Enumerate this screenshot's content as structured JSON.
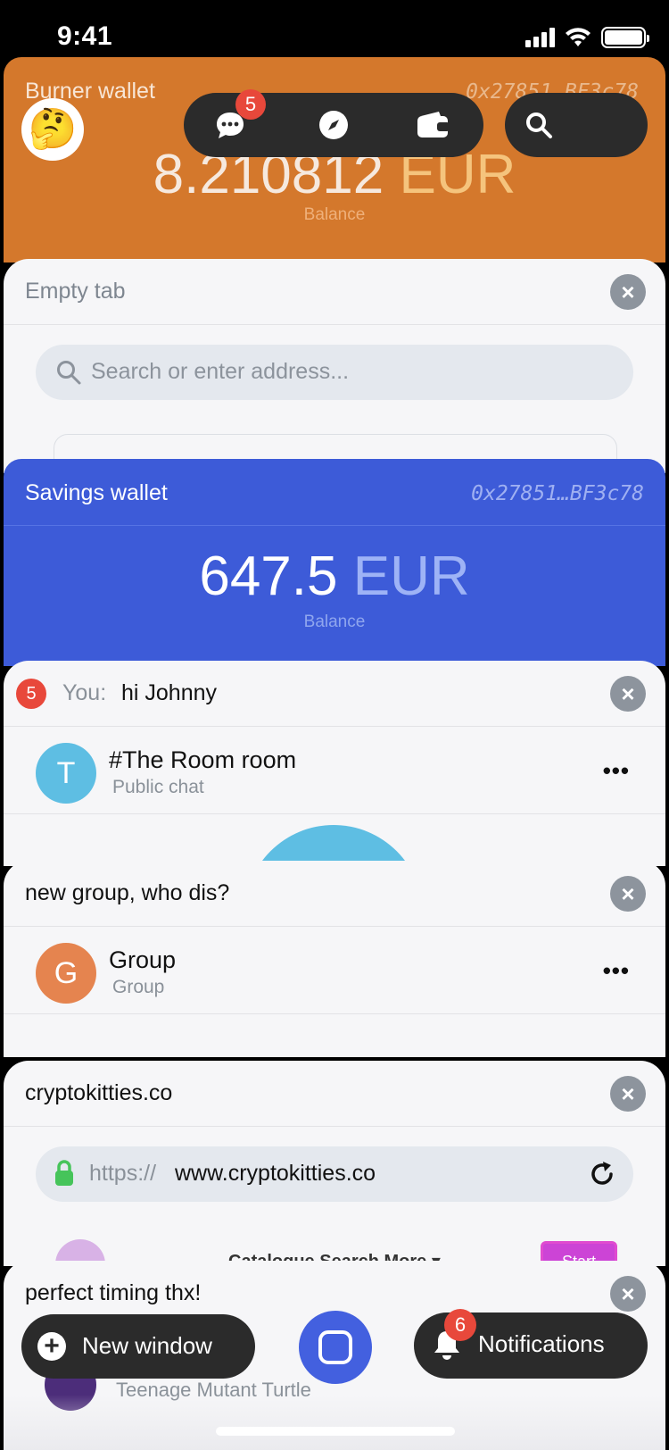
{
  "status_bar": {
    "time": "9:41"
  },
  "nav": {
    "chats_badge": "5",
    "search_placeholder": ""
  },
  "burner_wallet": {
    "title": "Burner wallet",
    "address": "0x27851…BF3c78",
    "amount": "8.210812",
    "currency": "EUR",
    "balance_label": "Balance"
  },
  "empty_tab": {
    "title": "Empty tab",
    "search_placeholder": "Search or enter address..."
  },
  "savings_wallet": {
    "title": "Savings wallet",
    "address": "0x27851…BF3c78",
    "amount": "647.5",
    "currency": "EUR",
    "balance_label": "Balance"
  },
  "room_chat": {
    "unread": "5",
    "sender": "You:",
    "preview": "hi Johnny",
    "avatar_letter": "T",
    "name": "#The Room room",
    "subtitle": "Public chat",
    "more": "•••"
  },
  "group_chat": {
    "preview": "new group, who dis?",
    "avatar_letter": "G",
    "name": "Group",
    "subtitle": "Group",
    "more": "•••"
  },
  "browser_tab": {
    "title": "cryptokitties.co",
    "protocol": "https://",
    "host": "www.cryptokitties.co",
    "peek_nav": "Catalogue   Search   More ▾",
    "peek_button": "Start"
  },
  "last_chat": {
    "preview": "perfect timing thx!",
    "subtitle": "Teenage Mutant Turtle"
  },
  "bottom_bar": {
    "new_window": "New window",
    "notifications": "Notifications",
    "notifications_badge": "6"
  },
  "icons": {
    "close": "×",
    "plus": "+"
  },
  "colors": {
    "burner": "#d4782c",
    "savings": "#3d5bd8",
    "accent": "#4360df",
    "badge": "#e8483b"
  }
}
